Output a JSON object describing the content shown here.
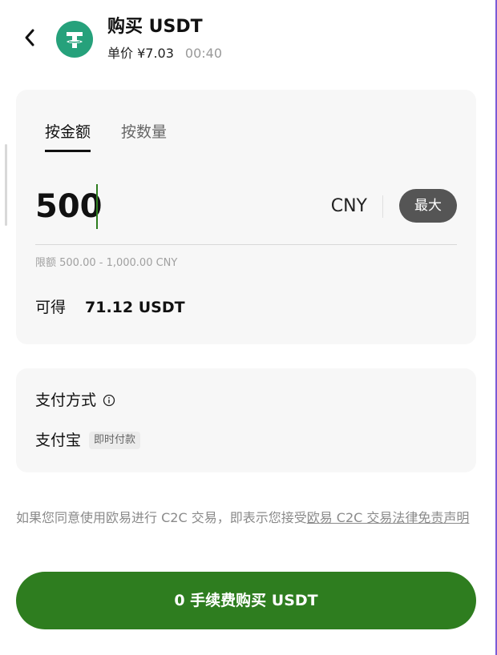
{
  "header": {
    "title": "购买 USDT",
    "unit_price": "单价 ¥7.03",
    "countdown": "00:40",
    "coin_icon": "tether-usdt-icon"
  },
  "tabs": [
    {
      "label": "按金额",
      "active": true
    },
    {
      "label": "按数量",
      "active": false
    }
  ],
  "amount": {
    "value": "500",
    "currency": "CNY",
    "max_label": "最大",
    "limit_text": "限额 500.00 - 1,000.00 CNY"
  },
  "receive": {
    "label": "可得",
    "value": "71.12 USDT"
  },
  "payment": {
    "label": "支付方式",
    "method": "支付宝",
    "tag": "即时付款"
  },
  "disclaimer": {
    "text": "如果您同意使用欧易进行 C2C 交易，即表示您接受",
    "link": "欧易 C2C 交易法律免责声明"
  },
  "buy_button": {
    "label": "0 手续费购买 USDT"
  },
  "colors": {
    "accent_green": "#2e7d1f",
    "tether_green": "#26a17b",
    "max_button": "#555555"
  }
}
